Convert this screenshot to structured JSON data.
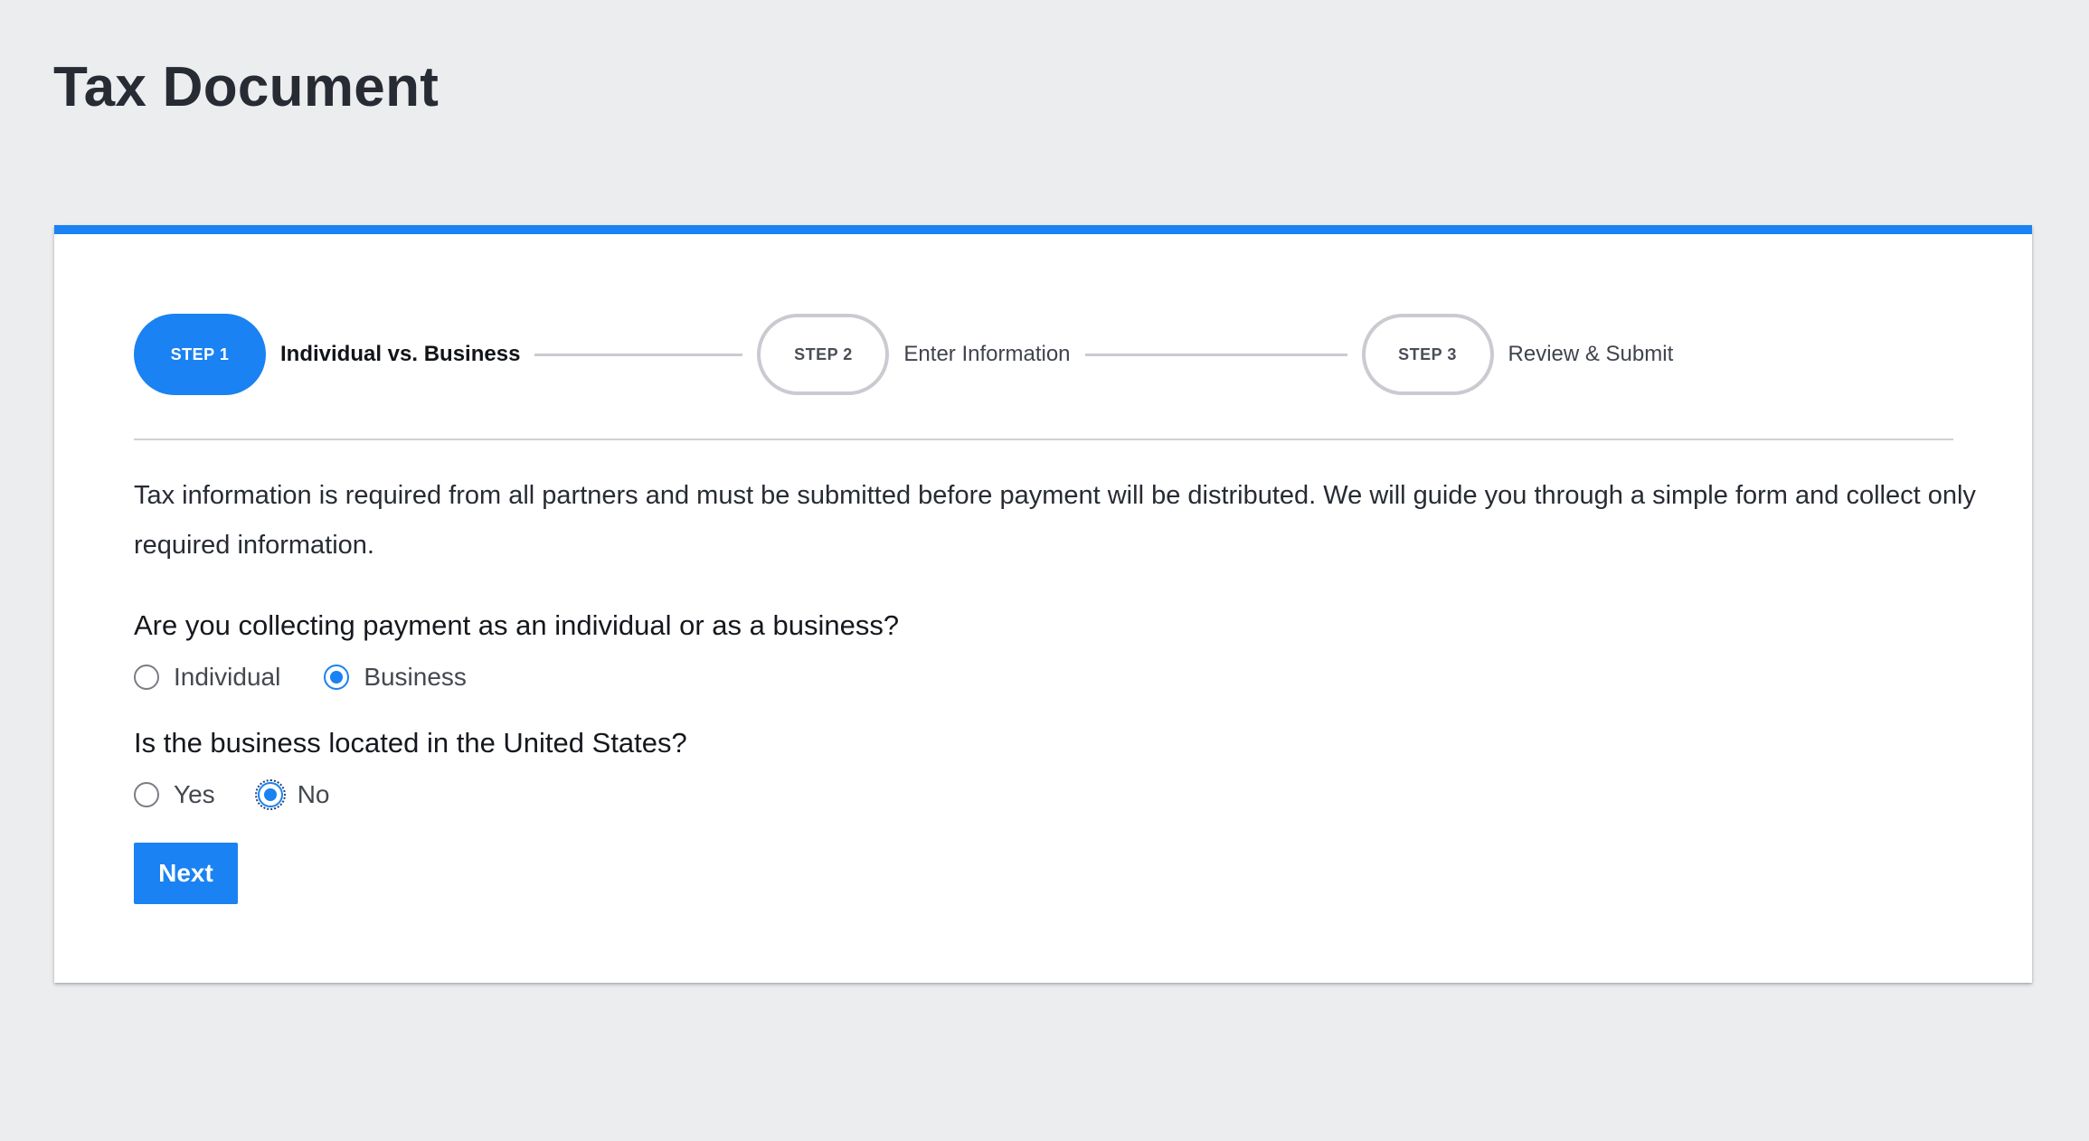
{
  "page": {
    "title": "Tax Document"
  },
  "stepper": {
    "steps": [
      {
        "badge": "STEP 1",
        "label": "Individual vs. Business",
        "state": "active"
      },
      {
        "badge": "STEP 2",
        "label": "Enter Information",
        "state": "inactive"
      },
      {
        "badge": "STEP 3",
        "label": "Review & Submit",
        "state": "inactive"
      }
    ]
  },
  "form": {
    "intro": "Tax information is required from all partners and must be submitted before payment will be distributed. We will guide you through a simple form and collect only required information.",
    "question_type": {
      "label": "Are you collecting payment as an individual or as a business?",
      "options": [
        {
          "label": "Individual",
          "checked": false
        },
        {
          "label": "Business",
          "checked": true
        }
      ]
    },
    "question_us": {
      "label": "Is the business located in the United States?",
      "options": [
        {
          "label": "Yes",
          "checked": false
        },
        {
          "label": "No",
          "checked": true,
          "focused": true
        }
      ]
    },
    "next_label": "Next"
  },
  "colors": {
    "accent": "#1A82F2",
    "background": "#ECEDEF",
    "card": "#FFFFFF",
    "text": "#272B33",
    "inactive_border": "#C9CBD0"
  },
  "icons": {
    "radio_unchecked": "radio-unchecked-icon",
    "radio_checked": "radio-checked-icon"
  }
}
